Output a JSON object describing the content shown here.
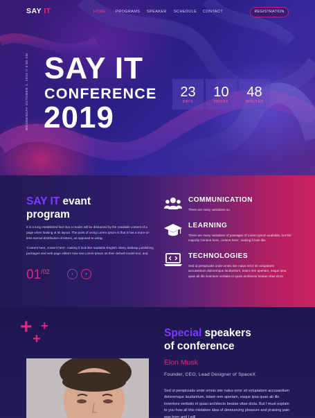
{
  "nav": {
    "logo_main": "SAY",
    "logo_accent": "IT",
    "links": [
      "HOME",
      "PROGRAMS",
      "SPEAKER",
      "SCHEDULE",
      "CONTACT"
    ],
    "active": "HOME",
    "register_label": "REGISTRATION"
  },
  "hero": {
    "vertical_date": "WEDNESDAY OCTOBER 1, 2019 // 6:00 AM",
    "title_line1": "SAY IT",
    "title_line2": "CONFERENCE",
    "title_line3": "2019",
    "countdown": [
      {
        "value": "23",
        "unit": "Days"
      },
      {
        "value": "10",
        "unit": "Hours"
      },
      {
        "value": "48",
        "unit": "Minutes"
      }
    ]
  },
  "event": {
    "title_accent": "SAY IT",
    "title_rest": " evant",
    "title_line2": "program",
    "para1": "It is a long established fact that a reader will be distracted by the readable content of a page when looking at its layout. The point of using Lorem Ipsum is that it has a more-or-less normal distribution of letters, as opposed to using.",
    "para2": "'Content here, content here', making it look like readable English. Many desktop publishing packages and web page editors now use Lorem Ipsum as their default model text, and.",
    "page_current": "01",
    "page_total": "/02",
    "prev_symbol": "‹",
    "next_symbol": "›",
    "features": [
      {
        "icon": "users-icon",
        "title": "COMMUNICATION",
        "desc": "There are many variations ou"
      },
      {
        "icon": "graduation-cap-icon",
        "title": "LEARNING",
        "desc": "There are many variations of passages of Lorem Ipsum available, but the majority Content here, content here', making it look like"
      },
      {
        "icon": "laptop-code-icon",
        "title": "TECHNOLOGIES",
        "desc": "Sed ut perspiciatis unde omnis iste natus error sit voluptatem accusantium doloremque laudantium, totam rem aperiam, eaque ipsa quae ab illo inventore veritatis et quasi architecto beatae vitae dicta"
      }
    ]
  },
  "speakers": {
    "title_accent": "Special",
    "title_rest": " speakers",
    "title_line2": "of conference",
    "name": "Elon Musk",
    "role": "Founder, CEO, Lead Designer of SpaceX",
    "desc": "Sed ut perspiciatis unde omnis iste natus error sit voluptatem accusantium doloremque laudantium, totam rem aperiam, eaque ipsa quae ab illo inventore veritatis et quasi architecto beatae vitae dicta. But I must explain to you how all this mistaken idea of denouncing pleasure and praising pain was born and I will"
  },
  "colors": {
    "accent_pink": "#e0287c",
    "accent_purple": "#7a3cff",
    "bg_dark": "#1f1750"
  }
}
